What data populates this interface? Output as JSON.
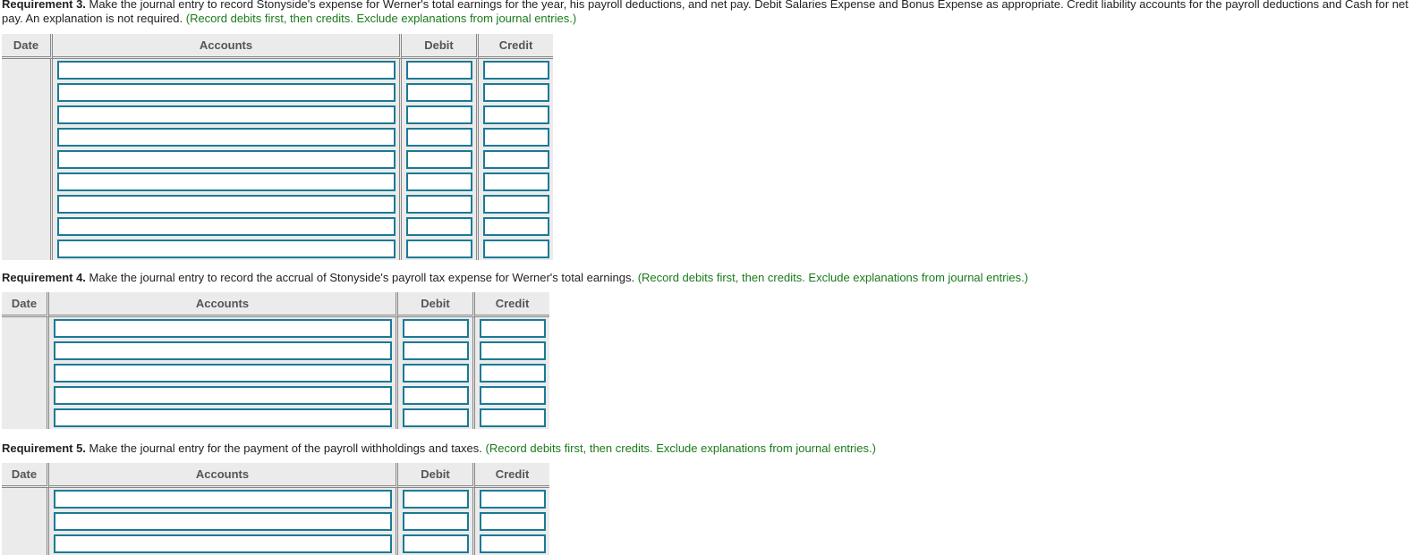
{
  "requirement3": {
    "label": "Requirement 3.",
    "text": " Make the journal entry to record Stonyside's expense for Werner's total earnings for the year, his payroll deductions, and net pay. Debit Salaries Expense and Bonus Expense as appropriate. Credit liability accounts for the payroll deductions and Cash for net pay. An explanation is not required. ",
    "hint": "(Record debits first, then credits. Exclude explanations from journal entries.)",
    "table": {
      "headers": {
        "date": "Date",
        "accounts": "Accounts",
        "debit": "Debit",
        "credit": "Credit"
      },
      "rows": [
        {
          "account": "",
          "debit": "",
          "credit": ""
        },
        {
          "account": "",
          "debit": "",
          "credit": ""
        },
        {
          "account": "",
          "debit": "",
          "credit": ""
        },
        {
          "account": "",
          "debit": "",
          "credit": ""
        },
        {
          "account": "",
          "debit": "",
          "credit": ""
        },
        {
          "account": "",
          "debit": "",
          "credit": ""
        },
        {
          "account": "",
          "debit": "",
          "credit": ""
        },
        {
          "account": "",
          "debit": "",
          "credit": ""
        },
        {
          "account": "",
          "debit": "",
          "credit": ""
        }
      ]
    }
  },
  "requirement4": {
    "label": "Requirement 4.",
    "text": " Make the journal entry to record the accrual of Stonyside's payroll tax expense for Werner's total earnings. ",
    "hint": "(Record debits first, then credits. Exclude explanations from journal entries.)",
    "table": {
      "headers": {
        "date": "Date",
        "accounts": "Accounts",
        "debit": "Debit",
        "credit": "Credit"
      },
      "rows": [
        {
          "account": "",
          "debit": "",
          "credit": ""
        },
        {
          "account": "",
          "debit": "",
          "credit": ""
        },
        {
          "account": "",
          "debit": "",
          "credit": ""
        },
        {
          "account": "",
          "debit": "",
          "credit": ""
        },
        {
          "account": "",
          "debit": "",
          "credit": ""
        }
      ]
    }
  },
  "requirement5": {
    "label": "Requirement 5.",
    "text": " Make the journal entry for the payment of the payroll withholdings and taxes. ",
    "hint": "(Record debits first, then credits. Exclude explanations from journal entries.)",
    "table": {
      "headers": {
        "date": "Date",
        "accounts": "Accounts",
        "debit": "Debit",
        "credit": "Credit"
      },
      "rows": [
        {
          "account": "",
          "debit": "",
          "credit": ""
        },
        {
          "account": "",
          "debit": "",
          "credit": ""
        },
        {
          "account": "",
          "debit": "",
          "credit": ""
        }
      ]
    }
  }
}
